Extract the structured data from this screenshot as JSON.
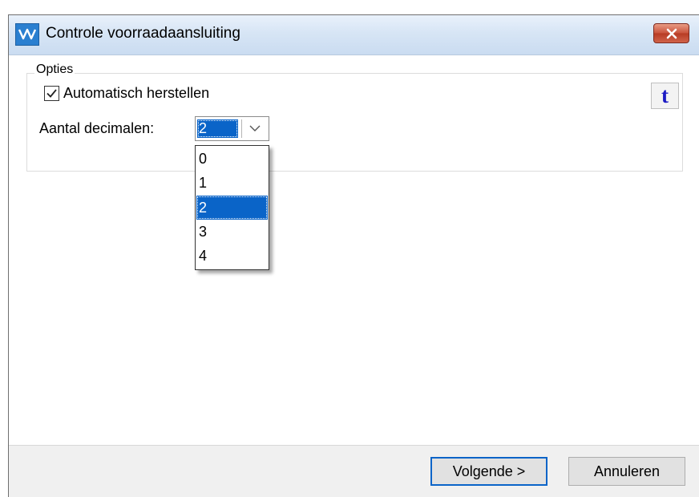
{
  "window": {
    "title": "Controle voorraadaansluiting"
  },
  "icons": {
    "app": "av-logo-icon",
    "close": "close-icon",
    "check": "checkmark-icon",
    "dropdown_arrow": "chevron-down-icon"
  },
  "options": {
    "group_label": "Opties",
    "auto_restore_label": "Automatisch herstellen",
    "auto_restore_checked": true,
    "t_button_label": "t",
    "decimals_label": "Aantal decimalen:",
    "decimals_value": "2",
    "decimals_options": [
      "0",
      "1",
      "2",
      "3",
      "4"
    ],
    "decimals_selected_index": 2
  },
  "footer": {
    "next_label": "Volgende >",
    "cancel_label": "Annuleren"
  },
  "colors": {
    "selection": "#0a64c8",
    "t_button_text": "#1c1bc4",
    "close_button": "#c9523b"
  }
}
